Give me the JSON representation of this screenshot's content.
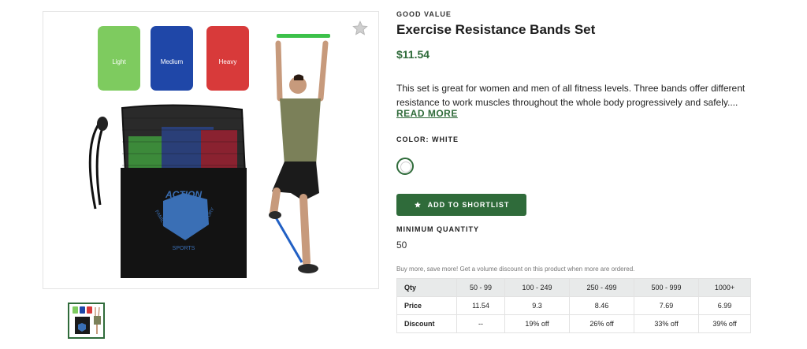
{
  "product": {
    "brand": "GOOD VALUE",
    "title": "Exercise Resistance Bands Set",
    "price": "$11.54",
    "description": "This set is great for women and men of all fitness levels. Three bands offer different resistance to work muscles throughout the whole body progressively and safely....",
    "read_more": "READ MORE"
  },
  "image": {
    "band_labels": [
      "Light",
      "Medium",
      "Heavy"
    ],
    "bag_logo": "ACTION",
    "bag_text_1": "FAMILY",
    "bag_text_2": "FACTORY",
    "bag_text_3": "SPORTS"
  },
  "color": {
    "label": "COLOR: WHITE",
    "swatch": "#ffffff"
  },
  "shortlist": {
    "label": "ADD TO SHORTLIST",
    "icon": "star-icon"
  },
  "minimum": {
    "label": "MINIMUM QUANTITY",
    "value": "50"
  },
  "volume_note": "Buy more, save more! Get a volume discount on this product when more are ordered.",
  "pricing_table": {
    "headers": [
      "Qty",
      "50 - 99",
      "100 - 249",
      "250 - 499",
      "500 - 999",
      "1000+"
    ],
    "rows": [
      [
        "Price",
        "11.54",
        "9.3",
        "8.46",
        "7.69",
        "6.99"
      ],
      [
        "Discount",
        "--",
        "19% off",
        "26% off",
        "33% off",
        "39% off"
      ]
    ]
  },
  "colors": {
    "accent": "#2f6b3a",
    "table_header_bg": "#e8eaea"
  }
}
